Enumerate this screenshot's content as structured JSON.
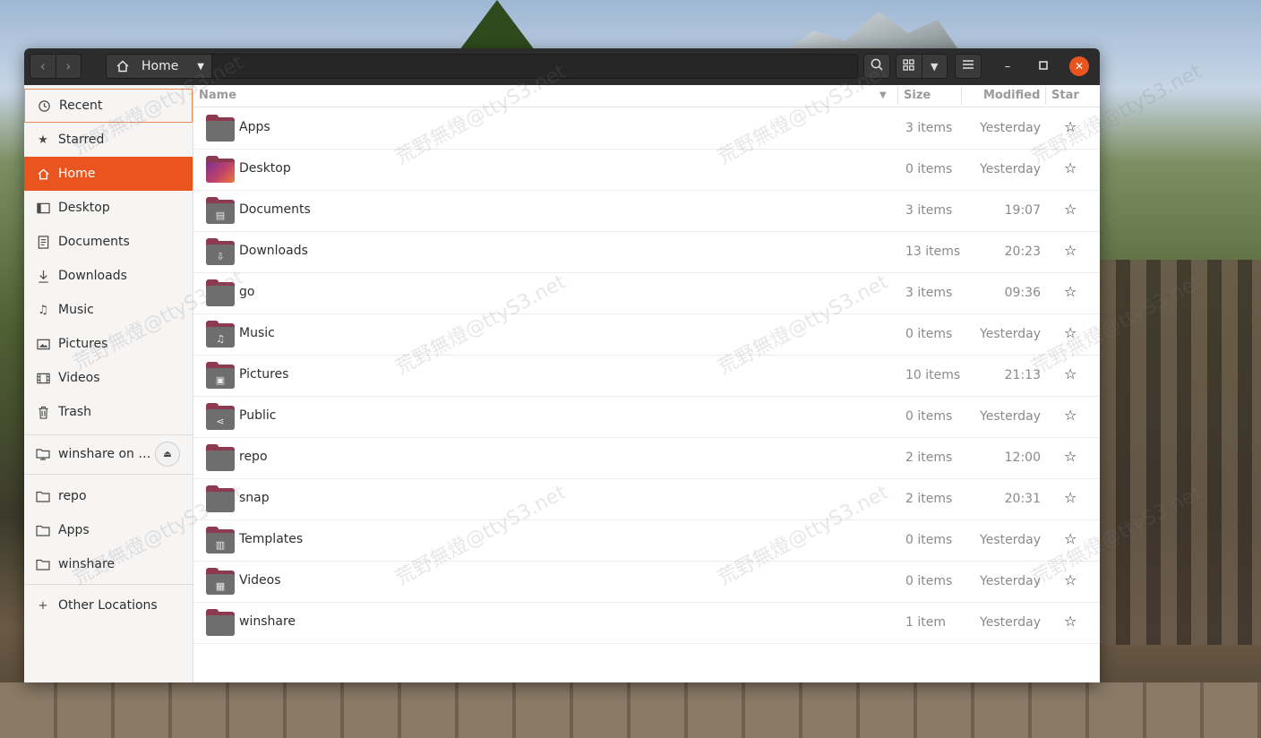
{
  "window": {
    "path": {
      "current": "Home"
    }
  },
  "sidebar": {
    "places": [
      {
        "label": "Recent",
        "icon": "clock-icon"
      },
      {
        "label": "Starred",
        "icon": "star-filled-icon"
      },
      {
        "label": "Home",
        "icon": "home-icon"
      },
      {
        "label": "Desktop",
        "icon": "desktop-icon"
      },
      {
        "label": "Documents",
        "icon": "document-icon"
      },
      {
        "label": "Downloads",
        "icon": "download-icon"
      },
      {
        "label": "Music",
        "icon": "music-note-icon"
      },
      {
        "label": "Pictures",
        "icon": "picture-icon"
      },
      {
        "label": "Videos",
        "icon": "film-icon"
      },
      {
        "label": "Trash",
        "icon": "trash-icon"
      }
    ],
    "mount": {
      "label": "winshare on …",
      "icon": "network-folder-icon"
    },
    "bookmarks": [
      {
        "label": "repo",
        "icon": "folder-icon"
      },
      {
        "label": "Apps",
        "icon": "folder-icon"
      },
      {
        "label": "winshare",
        "icon": "folder-icon"
      }
    ],
    "other": {
      "label": "Other Locations",
      "icon": "plus-icon"
    }
  },
  "columns": {
    "name": "Name",
    "size": "Size",
    "modified": "Modified",
    "star": "Star"
  },
  "files": [
    {
      "name": "Apps",
      "size": "3 items",
      "modified": "Yesterday",
      "emblem": ""
    },
    {
      "name": "Desktop",
      "size": "0 items",
      "modified": "Yesterday",
      "emblem": "desktop"
    },
    {
      "name": "Documents",
      "size": "3 items",
      "modified": "19:07",
      "emblem": "▤"
    },
    {
      "name": "Downloads",
      "size": "13 items",
      "modified": "20:23",
      "emblem": "⇩"
    },
    {
      "name": "go",
      "size": "3 items",
      "modified": "09:36",
      "emblem": ""
    },
    {
      "name": "Music",
      "size": "0 items",
      "modified": "Yesterday",
      "emblem": "♫"
    },
    {
      "name": "Pictures",
      "size": "10 items",
      "modified": "21:13",
      "emblem": "▣"
    },
    {
      "name": "Public",
      "size": "0 items",
      "modified": "Yesterday",
      "emblem": "⋖"
    },
    {
      "name": "repo",
      "size": "2 items",
      "modified": "12:00",
      "emblem": ""
    },
    {
      "name": "snap",
      "size": "2 items",
      "modified": "20:31",
      "emblem": ""
    },
    {
      "name": "Templates",
      "size": "0 items",
      "modified": "Yesterday",
      "emblem": "▥"
    },
    {
      "name": "Videos",
      "size": "0 items",
      "modified": "Yesterday",
      "emblem": "▦"
    },
    {
      "name": "winshare",
      "size": "1 item",
      "modified": "Yesterday",
      "emblem": ""
    }
  ],
  "watermark": "荒野無燈@ttyS3.net",
  "colors": {
    "accent": "#e9541f",
    "headerbar": "#2c2c2c",
    "folder_tab": "#8b3a50"
  }
}
